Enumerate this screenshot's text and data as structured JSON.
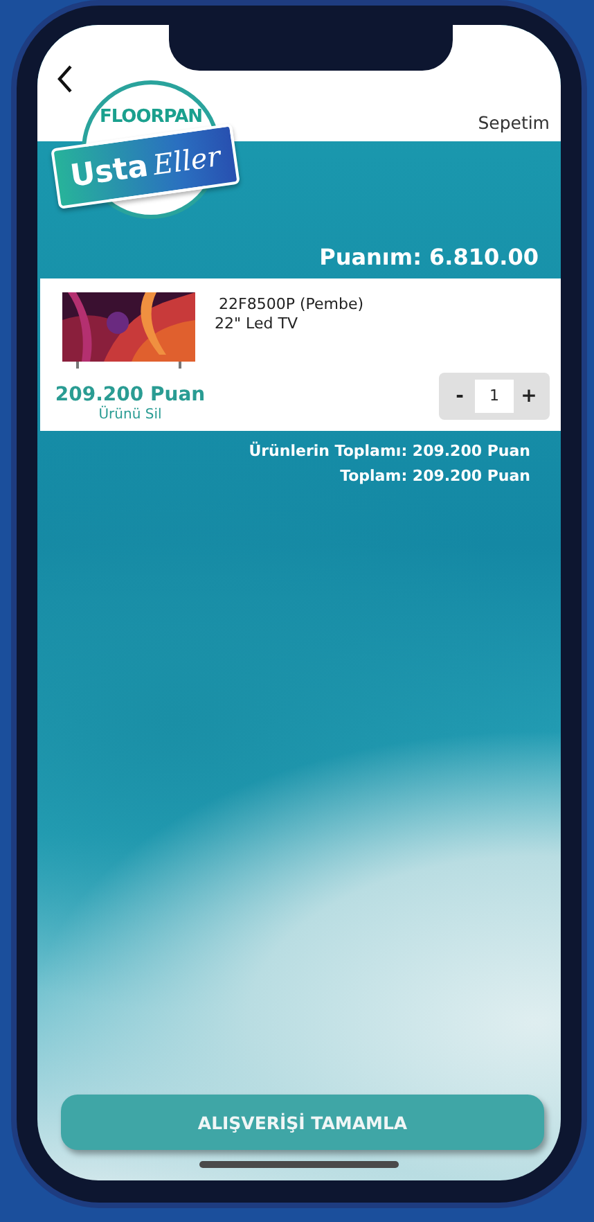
{
  "header": {
    "title": "Sepetim"
  },
  "logo": {
    "brand": "FLOORPAN",
    "word_1": "Usta",
    "word_2": "Eller"
  },
  "points": "Puanım: 6.810.00",
  "cart_items": [
    {
      "code": "22F8500P (Pembe)",
      "name": "22\" Led TV",
      "price": "209.200 Puan",
      "remove": "Ürünü Sil",
      "minus": "-",
      "quantity": "1",
      "plus": "+"
    }
  ],
  "totals": [
    "Ürünlerin Toplamı: 209.200 Puan",
    "Toplam: 209.200 Puan"
  ],
  "complete_button": "ALIŞVERİŞİ TAMAMLA"
}
